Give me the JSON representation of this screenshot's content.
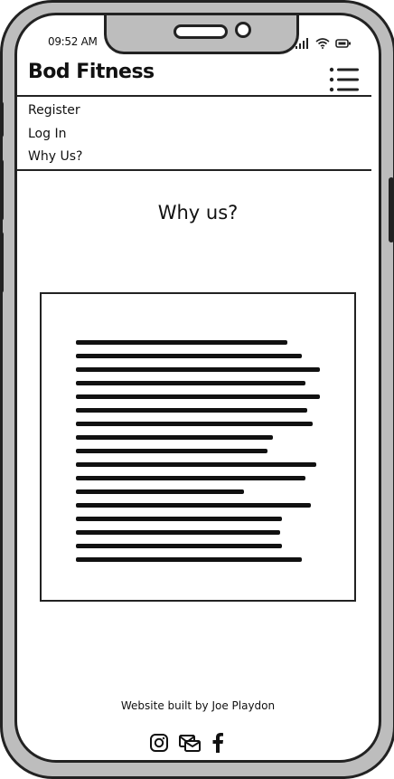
{
  "status": {
    "time": "09:52 AM"
  },
  "app": {
    "brand": "Bod Fitness",
    "menu_icon": "hamburger-menu-icon"
  },
  "nav": {
    "items": [
      {
        "label": "Register"
      },
      {
        "label": "Log In"
      },
      {
        "label": "Why Us?"
      }
    ]
  },
  "page": {
    "title": "Why us?"
  },
  "footer": {
    "credit": "Website built by Joe Playdon",
    "social_icons": [
      "instagram-icon",
      "email-icon",
      "facebook-icon"
    ]
  },
  "colors": {
    "frame": "#bdbdbd",
    "ink": "#222222",
    "screen": "#ffffff"
  }
}
